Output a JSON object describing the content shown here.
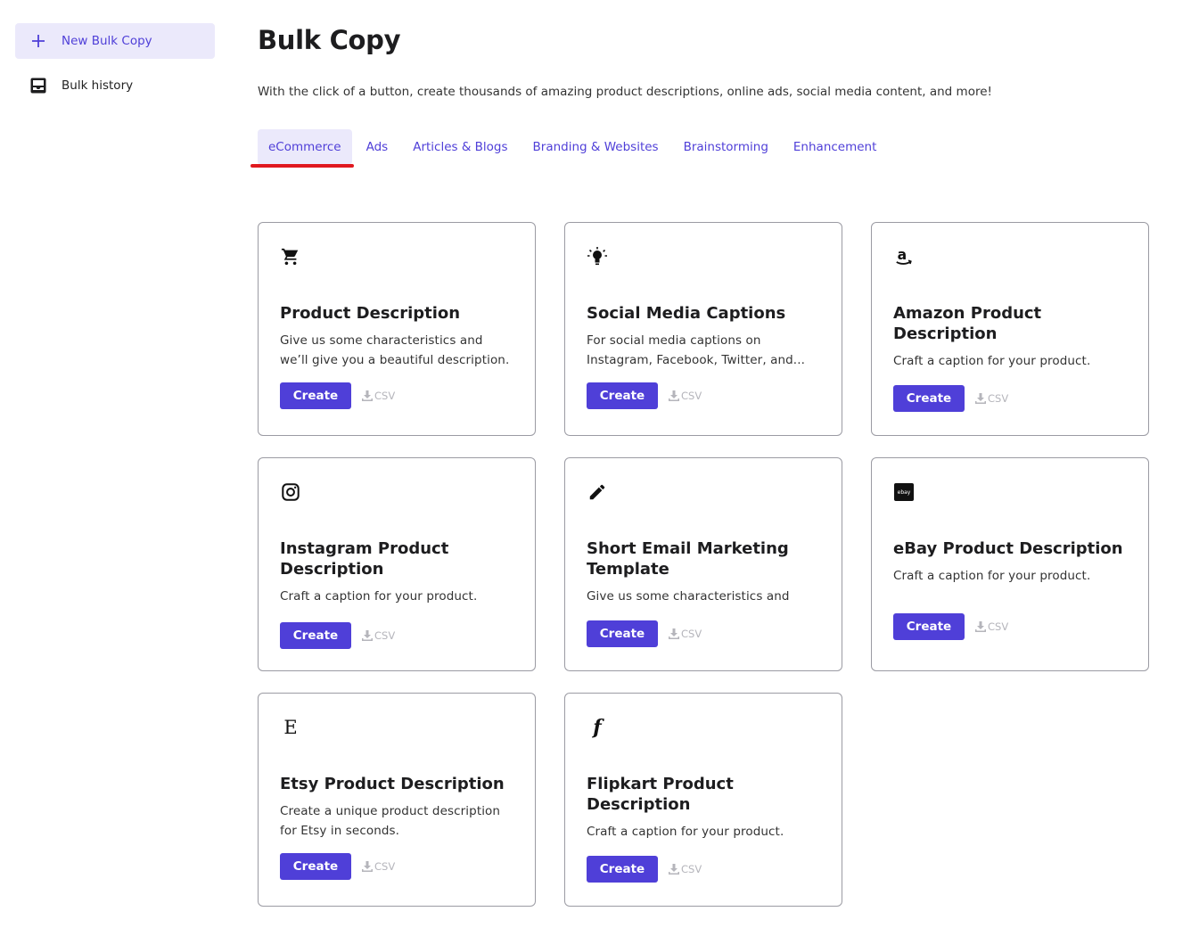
{
  "sidebar": {
    "items": [
      {
        "label": "New Bulk Copy",
        "icon": "plus-icon",
        "active": true
      },
      {
        "label": "Bulk history",
        "icon": "inbox-icon",
        "active": false
      }
    ]
  },
  "page": {
    "title": "Bulk Copy",
    "subtitle": "With the click of a button, create thousands of amazing product descriptions, online ads, social media content, and more!"
  },
  "tabs": [
    {
      "label": "eCommerce",
      "active": true
    },
    {
      "label": "Ads"
    },
    {
      "label": "Articles & Blogs"
    },
    {
      "label": "Branding & Websites"
    },
    {
      "label": "Brainstorming"
    },
    {
      "label": "Enhancement"
    }
  ],
  "cards": [
    {
      "title": "Product Description",
      "desc": "Give us some characteristics and we’ll give you a beautiful description.",
      "icon": "cart-icon"
    },
    {
      "title": "Social Media Captions",
      "desc": "For social media captions on Instagram, Facebook, Twitter, and...",
      "icon": "lightbulb-icon"
    },
    {
      "title": "Amazon Product Description",
      "desc": "Craft a caption for your product.",
      "icon": "amazon-icon"
    },
    {
      "title": "Instagram Product Description",
      "desc": "Craft a caption for your product.",
      "icon": "instagram-icon"
    },
    {
      "title": "Short Email Marketing Template",
      "desc": "Give us some characteristics and we’ll give you a beautiful short marketing template.",
      "icon": "pencil-icon"
    },
    {
      "title": "eBay Product Description",
      "desc": "Craft a caption for your product.",
      "icon": "ebay-icon",
      "icon_text": "ebay"
    },
    {
      "title": "Etsy Product Description",
      "desc": "Create a unique product description for Etsy in seconds.",
      "icon": "etsy-icon",
      "icon_text": "E"
    },
    {
      "title": "Flipkart Product Description",
      "desc": "Craft a caption for your product.",
      "icon": "flipkart-icon",
      "icon_text": "f"
    }
  ],
  "actions": {
    "create_label": "Create",
    "csv_label": "CSV"
  },
  "colors": {
    "accent": "#4f3fd8",
    "accent_bg": "#ebe9fb",
    "annotation_red": "#e0191f",
    "csv_gray": "#b5b5bb"
  }
}
